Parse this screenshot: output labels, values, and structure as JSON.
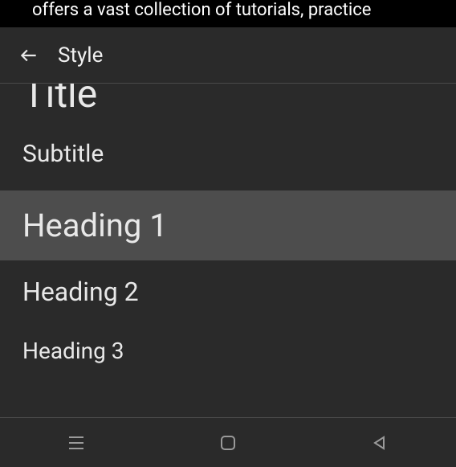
{
  "banner": {
    "text": "offers a vast collection of tutorials, practice"
  },
  "header": {
    "title": "Style"
  },
  "styles": {
    "title": "Title",
    "subtitle": "Subtitle",
    "heading1": "Heading 1",
    "heading2": "Heading 2",
    "heading3": "Heading 3",
    "selected": "heading1"
  },
  "colors": {
    "background": "#2a2a2a",
    "selected": "#4d4d4d",
    "text": "#e8e8e8",
    "divider": "#4a4a4a"
  }
}
